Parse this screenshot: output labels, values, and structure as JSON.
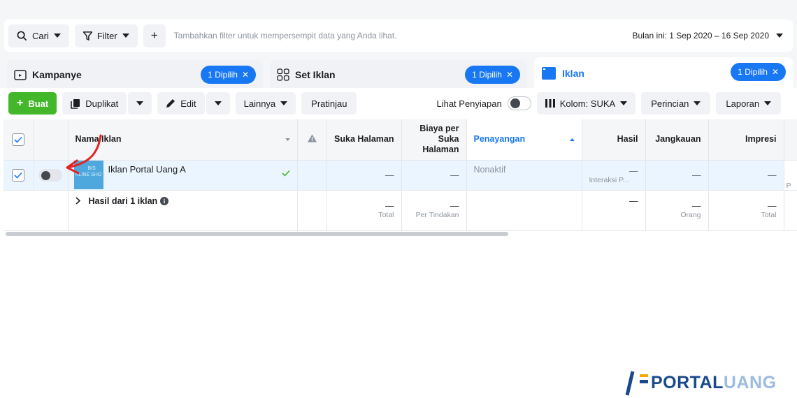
{
  "filter_bar": {
    "search_label": "Cari",
    "filter_label": "Filter",
    "add_label": "+",
    "hint": "Tambahkan filter untuk mempersempit data yang Anda lihat.",
    "date_range": "Bulan ini: 1 Sep 2020 – 16 Sep 2020"
  },
  "tabs": [
    {
      "label": "Kampanye",
      "pill": "1 Dipilih"
    },
    {
      "label": "Set Iklan",
      "pill": "1 Dipilih"
    },
    {
      "label": "Iklan",
      "pill": "1 Dipilih"
    }
  ],
  "toolbar": {
    "create_label": "Buat",
    "duplicate_label": "Duplikat",
    "edit_label": "Edit",
    "more_label": "Lainnya",
    "preview_label": "Pratinjau",
    "view_setup_label": "Lihat Penyiapan",
    "columns_label": "Kolom: SUKA",
    "breakdown_label": "Perincian",
    "report_label": "Laporan"
  },
  "table": {
    "headers": {
      "ad_name": "Nama Iklan",
      "page_likes": "Suka Halaman",
      "cost_per_like": "Biaya per Suka Halaman",
      "delivery": "Penayangan",
      "results": "Hasil",
      "reach": "Jangkauan",
      "impressions": "Impresi"
    },
    "row": {
      "ad_name": "Iklan Portal Uang A",
      "thumb_text_1": "BIS",
      "thumb_text_2": "NLINE SHO",
      "page_likes": "—",
      "cost_per_like": "—",
      "delivery": "Nonaktif",
      "results": "—",
      "results_sub": "Interaksi P...",
      "reach": "—",
      "impressions": "—",
      "overflow": "P"
    },
    "summary": {
      "label": "Hasil dari 1 iklan",
      "page_likes": "—",
      "page_likes_sub": "Total",
      "cost_per_like": "—",
      "cost_per_like_sub": "Per Tindakan",
      "results": "—",
      "reach": "—",
      "reach_sub": "Orang",
      "impressions": "—",
      "impressions_sub": "Total"
    }
  },
  "watermark": {
    "text_bold": "PORTAL",
    "text_light": "UANG"
  },
  "colors": {
    "accent": "#1877f2",
    "create_button": "#42b72a",
    "selected_row": "#ebf5ff",
    "annotation_arrow": "#e02424"
  }
}
